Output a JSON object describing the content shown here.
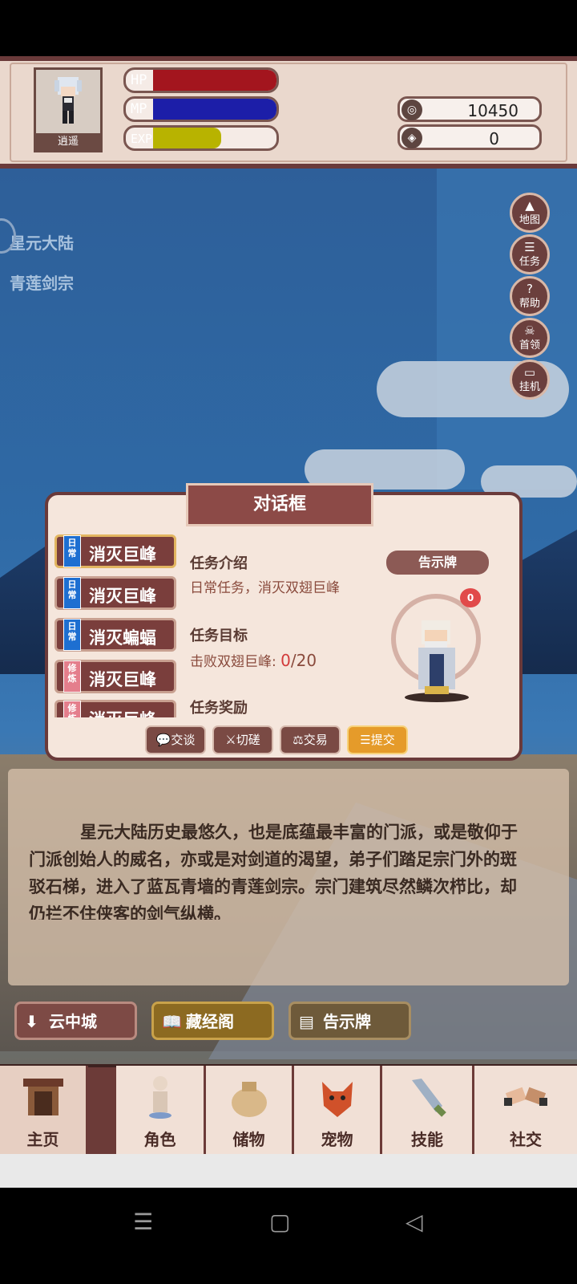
{
  "hud": {
    "player_name": "逍遥",
    "hp_label": "HP",
    "mp_label": "MP",
    "exp_label": "EXP",
    "hp_fill": 1.0,
    "mp_fill": 1.0,
    "exp_fill": 0.55,
    "coins": "10450",
    "gems": "0",
    "colors": {
      "hp": "#a3151e",
      "mp": "#1c1ea8",
      "exp": "#b8b300"
    }
  },
  "location": {
    "region": "星元大陆",
    "place": "青莲剑宗"
  },
  "side_menu": [
    {
      "icon": "mountain-icon",
      "label": "地图"
    },
    {
      "icon": "list-icon",
      "label": "任务"
    },
    {
      "icon": "question-icon",
      "label": "帮助"
    },
    {
      "icon": "demon-icon",
      "label": "首领"
    },
    {
      "icon": "monitor-icon",
      "label": "挂机"
    }
  ],
  "dialog": {
    "title": "对话框",
    "quests": [
      {
        "tag": "日常",
        "name": "消灭巨峰"
      },
      {
        "tag": "日常",
        "name": "消灭巨峰"
      },
      {
        "tag": "日常",
        "name": "消灭蝙蝠"
      },
      {
        "tag": "修炼",
        "name": "消灭巨峰"
      },
      {
        "tag": "修炼",
        "name": "消灭巨峰"
      }
    ],
    "intro_heading": "任务介绍",
    "intro_text": "日常任务，消灭双翅巨峰",
    "goal_heading": "任务目标",
    "goal_text": "击败双翅巨峰: ",
    "goal_progress": "0",
    "goal_total": "/20",
    "reward_heading": "任务奖励",
    "npc_name": "告示牌",
    "npc_heart": "0",
    "actions": [
      {
        "icon": "chat-icon",
        "label": "交谈"
      },
      {
        "icon": "sword-icon",
        "label": "切磋"
      },
      {
        "icon": "scale-icon",
        "label": "交易"
      },
      {
        "icon": "list-icon",
        "label": "提交"
      }
    ]
  },
  "story": "星元大陆历史最悠久，也是底蕴最丰富的门派，或是敬仰于门派创始人的威名，亦或是对剑道的渴望，弟子们踏足宗门外的斑驳石梯，进入了蓝瓦青墙的青莲剑宗。宗门建筑尽然鳞次栉比，却仍拦不住侠客的剑气纵横。",
  "nav_buttons": [
    {
      "icon": "arrow-down-icon",
      "label": "云中城"
    },
    {
      "icon": "book-icon",
      "label": "藏经阁"
    },
    {
      "icon": "signboard-icon",
      "label": "告示牌"
    }
  ],
  "tabs": [
    {
      "icon": "gate-icon",
      "label": "主页"
    },
    {
      "icon": "character-icon",
      "label": "角色"
    },
    {
      "icon": "bag-icon",
      "label": "储物"
    },
    {
      "icon": "pet-icon",
      "label": "宠物"
    },
    {
      "icon": "blade-icon",
      "label": "技能"
    },
    {
      "icon": "handshake-icon",
      "label": "社交"
    }
  ]
}
